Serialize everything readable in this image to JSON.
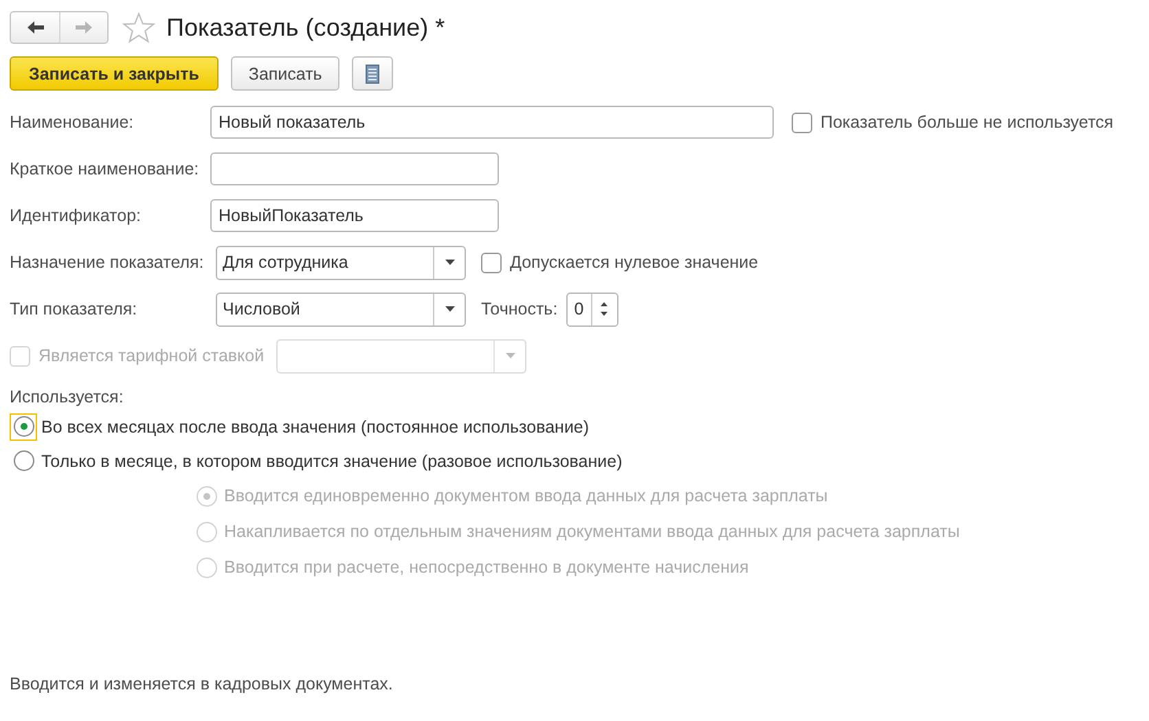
{
  "nav": [
    {
      "kind": "back",
      "disabled": false
    },
    {
      "kind": "forward",
      "disabled": true
    }
  ],
  "favorite": false,
  "title": "Показатель (создание) *",
  "toolbar": [
    {
      "kind": "primary",
      "label": "Записать и закрыть"
    },
    {
      "kind": "normal",
      "label": "Записать"
    },
    {
      "kind": "icon"
    }
  ],
  "name": {
    "label": "Наименование:",
    "value": "Новый показатель"
  },
  "not_used": {
    "label": "Показатель больше не используется",
    "checked": false
  },
  "short_name": {
    "label": "Краткое наименование:"
  },
  "identifier": {
    "label": "Идентификатор:",
    "value": "НовыйПоказатель"
  },
  "purpose": {
    "label": "Назначение показателя:",
    "value": "Для сотрудника"
  },
  "zero_allowed": {
    "label": "Допускается нулевое значение",
    "checked": false
  },
  "type": {
    "label": "Тип показателя:",
    "value": "Числовой"
  },
  "precision": {
    "label": "Точность:",
    "value": "0"
  },
  "tariff": {
    "label": "Является тарифной ставкой",
    "checked": false,
    "disabled": true
  },
  "usage": {
    "label": "Используется:",
    "options": [
      {
        "label": "Во всех месяцах после ввода значения (постоянное использование)",
        "selected": true,
        "focused": true
      },
      {
        "label": "Только в месяце, в котором вводится значение (разовое использование)",
        "selected": false,
        "focused": false
      }
    ],
    "sub_options": [
      {
        "label": "Вводится единовременно документом ввода данных для расчета зарплаты",
        "selected": true,
        "disabled": true
      },
      {
        "label": "Накапливается по отдельным значениям документами ввода данных для расчета зарплаты",
        "selected": false,
        "disabled": true
      },
      {
        "label": "Вводится при расчете, непосредственно в документе начисления",
        "selected": false,
        "disabled": true
      }
    ]
  },
  "footer": "Вводится и изменяется в кадровых документах."
}
